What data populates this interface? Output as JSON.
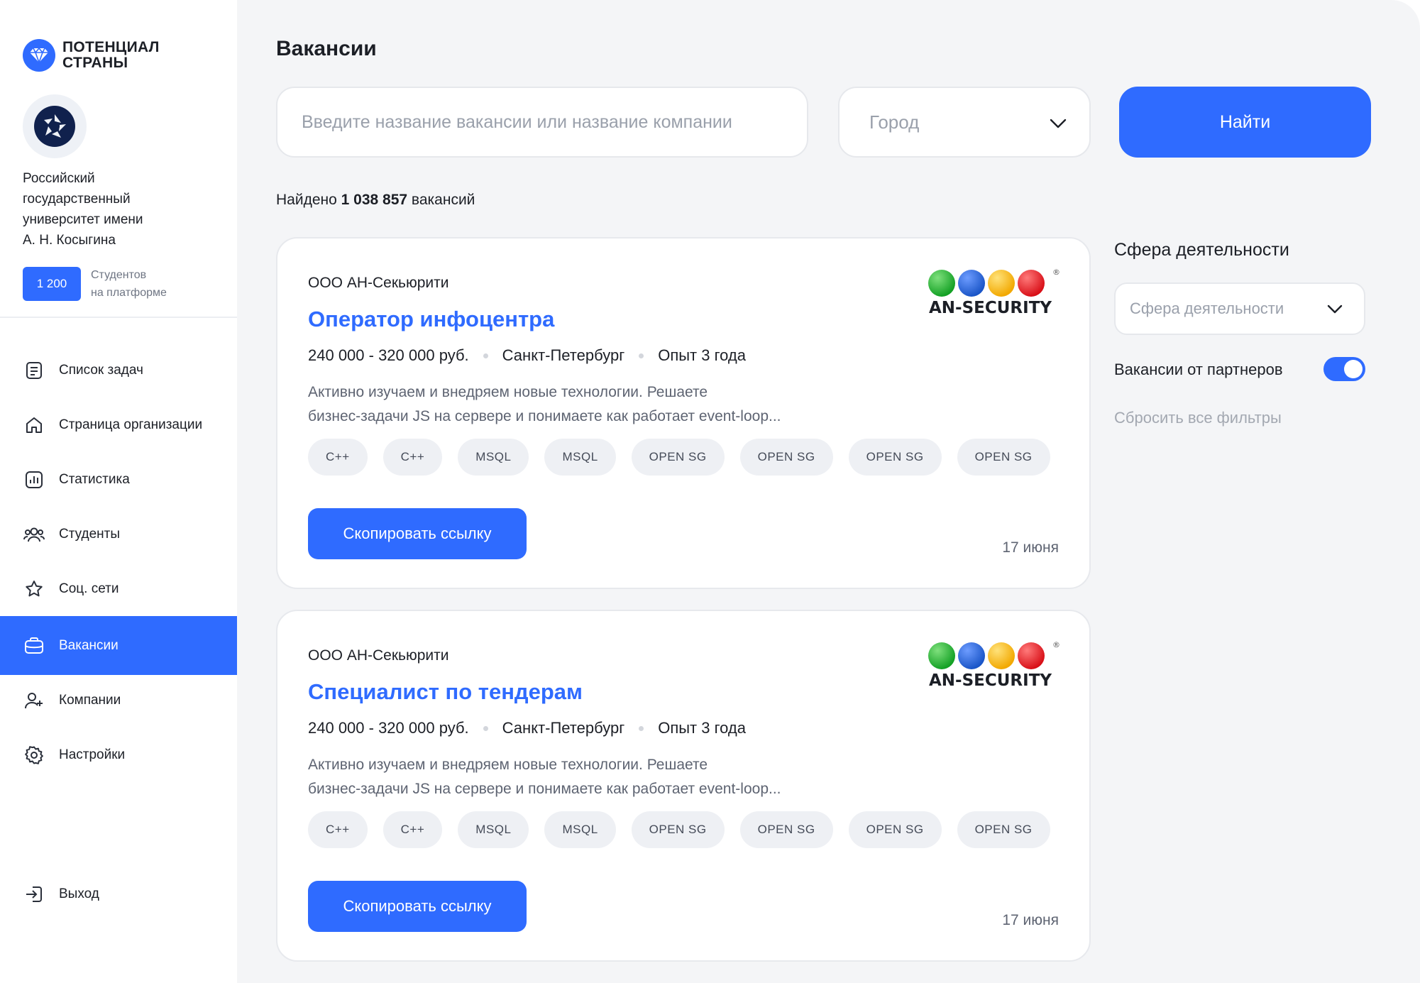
{
  "brand": {
    "line1": "ПОТЕНЦИАЛ",
    "line2": "СТРАНЫ"
  },
  "org": {
    "name_lines": [
      "Российский",
      "государственный",
      "университет имени",
      "А. Н. Косыгина"
    ],
    "students_count": "1 200",
    "students_label_lines": [
      "Студентов",
      "на платформе"
    ]
  },
  "nav": {
    "items": [
      {
        "label": "Список задач",
        "icon": "task-list-icon"
      },
      {
        "label": "Страница организации",
        "icon": "home-icon"
      },
      {
        "label": "Статистика",
        "icon": "chart-icon"
      },
      {
        "label": "Студенты",
        "icon": "users-icon"
      },
      {
        "label": "Соц. сети",
        "icon": "star-icon"
      },
      {
        "label": "Вакансии",
        "icon": "briefcase-icon",
        "active": true
      },
      {
        "label": "Компании",
        "icon": "user-plus-icon"
      },
      {
        "label": "Настройки",
        "icon": "gear-icon"
      }
    ],
    "logout": {
      "label": "Выход",
      "icon": "logout-icon"
    }
  },
  "main": {
    "title": "Вакансии",
    "search_placeholder": "Введите название вакансии или название компании",
    "city_placeholder": "Город",
    "find_label": "Найти",
    "found_prefix": "Найдено",
    "found_count": "1 038 857",
    "found_suffix": "вакансий"
  },
  "vacancies": [
    {
      "company": "ООО АН-Секьюрити",
      "title": "Оператор инфоцентра",
      "salary": "240 000 - 320 000 руб.",
      "city": "Санкт-Петербург",
      "experience": "Опыт 3 года",
      "desc_lines": [
        "Активно изучаем и внедряем новые технологии. Решаете",
        "бизнес-задачи JS на сервере и понимаете как работает event-loop..."
      ],
      "tags": [
        "C++",
        "C++",
        "MSQL",
        "MSQL",
        "OPEN SG",
        "OPEN SG",
        "OPEN SG",
        "OPEN SG"
      ],
      "copy_label": "Скопировать ссылку",
      "date": "17 июня",
      "logo_text": "AN-SECURITY"
    },
    {
      "company": "ООО АН-Секьюрити",
      "title": "Специалист по тендерам",
      "salary": "240 000 - 320 000 руб.",
      "city": "Санкт-Петербург",
      "experience": "Опыт 3 года",
      "desc_lines": [
        "Активно изучаем и внедряем новые технологии. Решаете",
        "бизнес-задачи JS на сервере и понимаете как работает event-loop..."
      ],
      "tags": [
        "C++",
        "C++",
        "MSQL",
        "MSQL",
        "OPEN SG",
        "OPEN SG",
        "OPEN SG",
        "OPEN SG"
      ],
      "copy_label": "Скопировать ссылку",
      "date": "17 июня",
      "logo_text": "AN-SECURITY"
    }
  ],
  "filters": {
    "title": "Сфера деятельности",
    "sphere_placeholder": "Сфера деятельности",
    "partners_label": "Вакансии от партнеров",
    "partners_enabled": true,
    "reset_label": "Сбросить все фильтры"
  },
  "colors": {
    "accent": "#2f6bff",
    "background": "#f4f5f7",
    "logo_dots": [
      "#1aa52a",
      "#1f5fd1",
      "#f7b500",
      "#e0121b"
    ]
  }
}
